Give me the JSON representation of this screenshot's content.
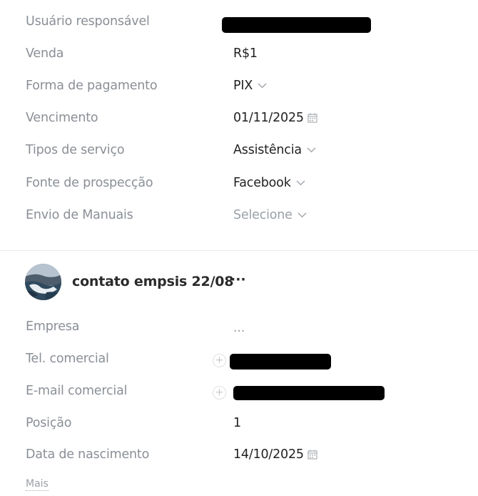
{
  "deal_fields": [
    {
      "label": "Usuário responsável",
      "value": ""
    },
    {
      "label": "Venda",
      "value": "R$1"
    },
    {
      "label": "Forma de pagamento",
      "value": "PIX"
    },
    {
      "label": "Vencimento",
      "value": "01/11/2025"
    },
    {
      "label": "Tipos de serviço",
      "value": "Assistência"
    },
    {
      "label": "Fonte de prospecção",
      "value": "Facebook"
    },
    {
      "label": "Envio de Manuais",
      "value": "Selecione"
    }
  ],
  "contact": {
    "name": "contato empsis 22/08",
    "more": "···"
  },
  "contact_fields": [
    {
      "label": "Empresa",
      "value": "..."
    },
    {
      "label": "Tel. comercial",
      "value": ""
    },
    {
      "label": "E-mail comercial",
      "value": ""
    },
    {
      "label": "Posição",
      "value": "1"
    },
    {
      "label": "Data de nascimento",
      "value": "14/10/2025"
    }
  ],
  "mais_label": "Mais",
  "icons": {
    "dropdown": "chevron-down-icon",
    "calendar": "calendar-icon",
    "add": "plus-icon"
  },
  "colors": {
    "label": "#8a8f96",
    "value": "#222222",
    "placeholder": "#9aa0a6"
  }
}
